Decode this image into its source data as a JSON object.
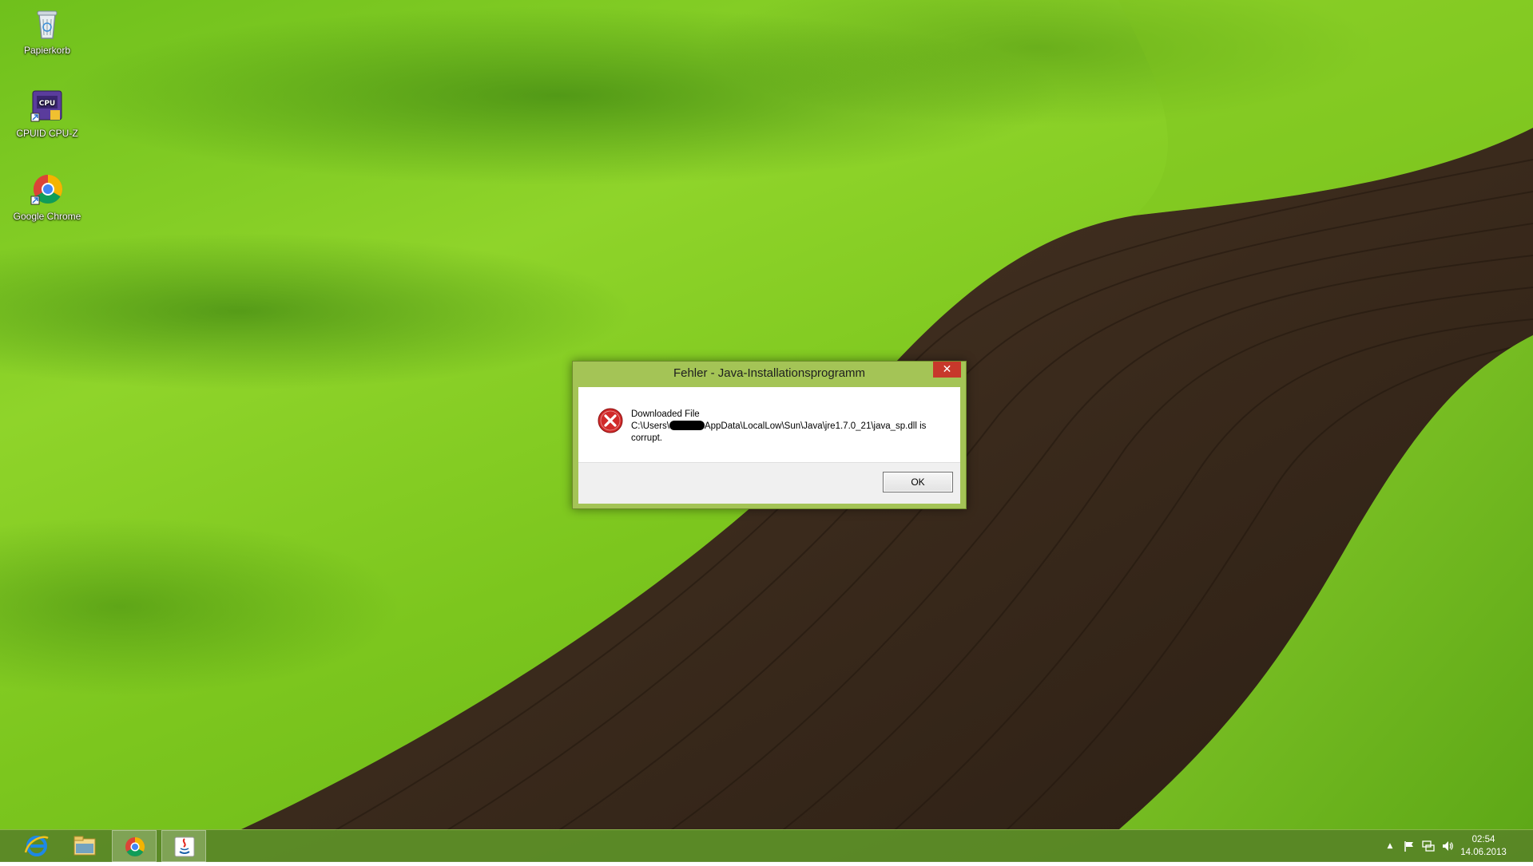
{
  "desktop": {
    "icons": [
      {
        "label": "Papierkorb"
      },
      {
        "label": "CPUID CPU-Z"
      },
      {
        "label": "Google Chrome"
      }
    ]
  },
  "dialog": {
    "title": "Fehler - Java-Installationsprogramm",
    "close_symbol": "✕",
    "icon": "error-icon",
    "message_line1": "Downloaded File",
    "message_path_prefix": "C:\\Users\\",
    "message_path_suffix": "AppData\\LocalLow\\Sun\\Java\\jre1.7.0_21\\java_sp.dll is",
    "message_line3": "corrupt.",
    "ok_label": "OK"
  },
  "taskbar": {
    "apps": [
      {
        "icon": "internet-explorer-icon",
        "active": false
      },
      {
        "icon": "file-explorer-icon",
        "active": false
      },
      {
        "icon": "chrome-icon",
        "active": true
      },
      {
        "icon": "java-icon",
        "active": true
      }
    ],
    "tray": {
      "overflow_symbol": "▲",
      "icons": [
        "action-center-flag-icon",
        "network-icon",
        "volume-icon"
      ]
    },
    "clock": {
      "time": "02:54",
      "date": "14.06.2013"
    }
  },
  "colors": {
    "dialog_frame": "#a4c456",
    "close_button": "#c7382b",
    "taskbar": "#58822a"
  }
}
